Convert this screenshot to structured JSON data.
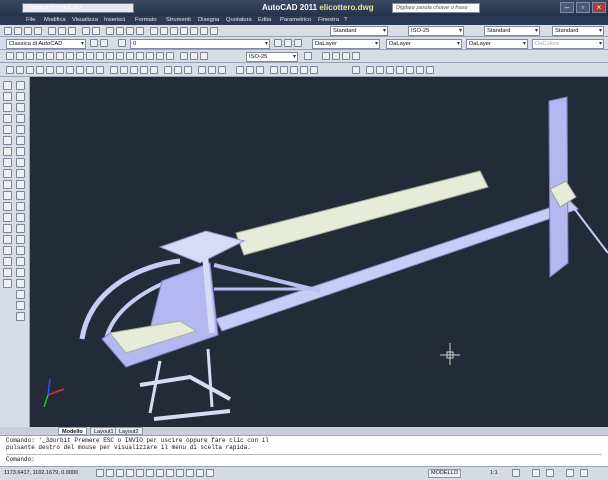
{
  "app": {
    "title": "AutoCAD 2011",
    "document": "elicottero.dwg",
    "workspace": "Classica di AutoCAD",
    "search_placeholder": "Digitare parola chiave o frase"
  },
  "menu": [
    "File",
    "Modifica",
    "Visualizza",
    "Inserisci",
    "Formato",
    "Strumenti",
    "Disegna",
    "Quotatura",
    "Edita",
    "Parametrico",
    "Finestra",
    "?"
  ],
  "toolbar": {
    "text_style": "Standard",
    "dim_style": "ISO-25",
    "table_style": "Standard",
    "mleader_style": "Standard",
    "workspace_combo": "Classica di AutoCAD",
    "layer": "0",
    "color": "DaLayer",
    "linetype": "DaLayer",
    "lineweight": "DaLayer",
    "plotstyle": "DaColore",
    "dim_style_2": "ISO-25"
  },
  "tabs": [
    {
      "label": "Modello",
      "active": true
    },
    {
      "label": "Layout1",
      "active": false
    },
    {
      "label": "Layout2",
      "active": false
    }
  ],
  "command": {
    "line1": "Comando: '_3dorbit Premere ESC o INVIO per uscire oppure fare clic con il",
    "line2": "pulsante destro del mouse per visualizzare il menu di scelta rapida.",
    "prompt": "Comando:"
  },
  "status": {
    "coords": "1173.6417, 1102.1679, 0.0000",
    "model": "MODELLO",
    "scale": "1:1"
  },
  "colors": {
    "viewport_bg": "#242b38",
    "model_fill": "#b4b8f0",
    "blade_fill": "#e6ecd8",
    "ucs_x": "#e03030",
    "ucs_y": "#30c030",
    "ucs_z": "#3050f0"
  }
}
